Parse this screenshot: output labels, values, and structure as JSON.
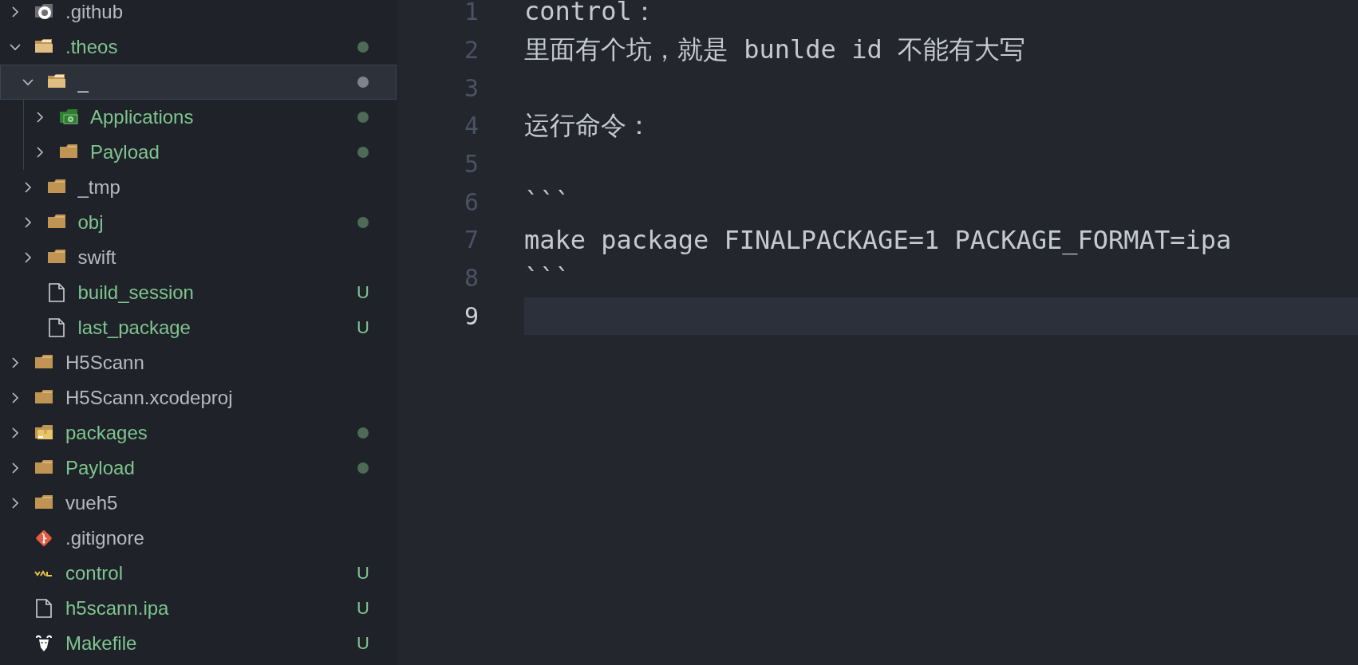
{
  "explorer": {
    "items": [
      {
        "name": ".github",
        "kind": "badged-folder",
        "expanded": false,
        "selected": false,
        "modified": false,
        "dot": false
      },
      {
        "name": ".theos",
        "kind": "open-folder",
        "expanded": true,
        "selected": false,
        "modified": true,
        "dot": true,
        "children": [
          {
            "name": "_",
            "kind": "open-folder",
            "expanded": true,
            "selected": true,
            "modified": true,
            "dot": true,
            "children": [
              {
                "name": "Applications",
                "kind": "gear-folder",
                "expanded": false,
                "selected": false,
                "modified": true,
                "dot": true
              },
              {
                "name": "Payload",
                "kind": "folder",
                "expanded": false,
                "selected": false,
                "modified": true,
                "dot": true
              }
            ]
          },
          {
            "name": "_tmp",
            "kind": "folder",
            "expanded": false,
            "selected": false,
            "modified": false,
            "dot": false
          },
          {
            "name": "obj",
            "kind": "folder",
            "expanded": false,
            "selected": false,
            "modified": true,
            "dot": true
          },
          {
            "name": "swift",
            "kind": "folder",
            "expanded": false,
            "selected": false,
            "modified": false,
            "dot": false
          },
          {
            "name": "build_session",
            "kind": "file",
            "selected": false,
            "modified": true,
            "dot": false,
            "badge": "U"
          },
          {
            "name": "last_package",
            "kind": "file",
            "selected": false,
            "modified": true,
            "dot": false,
            "badge": "U"
          }
        ]
      },
      {
        "name": "H5Scann",
        "kind": "folder",
        "expanded": false,
        "selected": false,
        "modified": false,
        "dot": false
      },
      {
        "name": "H5Scann.xcodeproj",
        "kind": "folder",
        "expanded": false,
        "selected": false,
        "modified": false,
        "dot": false
      },
      {
        "name": "packages",
        "kind": "box-folder",
        "expanded": false,
        "selected": false,
        "modified": true,
        "dot": true
      },
      {
        "name": "Payload",
        "kind": "folder",
        "expanded": false,
        "selected": false,
        "modified": true,
        "dot": true
      },
      {
        "name": "vueh5",
        "kind": "folder",
        "expanded": false,
        "selected": false,
        "modified": false,
        "dot": false
      },
      {
        "name": ".gitignore",
        "kind": "git",
        "selected": false,
        "modified": false,
        "dot": false
      },
      {
        "name": "control",
        "kind": "yml",
        "selected": false,
        "modified": true,
        "dot": false,
        "badge": "U"
      },
      {
        "name": "h5scann.ipa",
        "kind": "file",
        "selected": false,
        "modified": true,
        "dot": false,
        "badge": "U"
      },
      {
        "name": "Makefile",
        "kind": "gnu",
        "selected": false,
        "modified": true,
        "dot": false,
        "badge": "U"
      }
    ]
  },
  "editor": {
    "lines": [
      {
        "number": "1",
        "text": "control：",
        "selected": false
      },
      {
        "number": "2",
        "text": "里面有个坑，就是 bunlde id 不能有大写",
        "selected": false
      },
      {
        "number": "3",
        "selected": false
      },
      {
        "number": "4",
        "text": "运行命令：",
        "selected": false
      },
      {
        "number": "5",
        "selected": false
      },
      {
        "number": "6",
        "text": "```",
        "selected": false
      },
      {
        "number": "7",
        "text": "make package FINALPACKAGE=1 PACKAGE_FORMAT=ipa",
        "selected": false
      },
      {
        "number": "8",
        "text": "```",
        "selected": false
      },
      {
        "number": "9",
        "selected": true
      }
    ]
  }
}
